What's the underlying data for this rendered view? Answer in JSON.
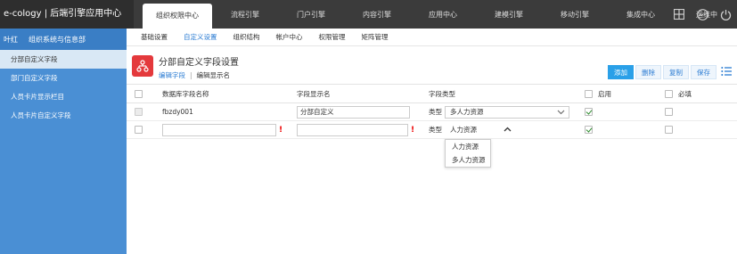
{
  "app": {
    "title": "e-cology | 后端引擎应用中心"
  },
  "topnav": [
    {
      "label": "组织权限中心",
      "active": true
    },
    {
      "label": "流程引擎"
    },
    {
      "label": "门户引擎"
    },
    {
      "label": "内容引擎"
    },
    {
      "label": "应用中心"
    },
    {
      "label": "建模引擎"
    },
    {
      "label": "移动引擎"
    },
    {
      "label": "集成中心"
    },
    {
      "label": "运维中"
    }
  ],
  "top_icons": [
    "grid-icon",
    "more-icon",
    "power-icon"
  ],
  "sidebar": {
    "user": "叶红",
    "dept": "组织系统与信息部",
    "items": [
      {
        "label": "分部自定义字段",
        "active": true
      },
      {
        "label": "部门自定义字段"
      },
      {
        "label": "人员卡片显示栏目"
      },
      {
        "label": "人员卡片自定义字段"
      }
    ]
  },
  "subnav": [
    {
      "label": "基础设置"
    },
    {
      "label": "自定义设置",
      "active": true
    },
    {
      "label": "组织结构"
    },
    {
      "label": "帐户中心"
    },
    {
      "label": "权限管理"
    },
    {
      "label": "矩阵管理"
    }
  ],
  "page": {
    "title": "分部自定义字段设置",
    "link_edit_fields": "编辑字段",
    "link_edit_display": "编辑显示名",
    "icon": "org-chart-icon"
  },
  "actions": {
    "add": "添加",
    "delete": "删除",
    "copy": "复制",
    "save": "保存"
  },
  "table": {
    "columns": {
      "db_name": "数据库字段名称",
      "display_name": "字段显示名",
      "type": "字段类型",
      "enabled": "启用",
      "required": "必填"
    },
    "rows": [
      {
        "db_name": "fbzdy001",
        "display_name": "分部自定义",
        "type_prefix": "类型",
        "type_value": "多人力资源",
        "enabled": true,
        "required": false
      },
      {
        "db_name": "",
        "display_name": "",
        "type_prefix": "类型",
        "type_value": "人力资源",
        "enabled": true,
        "required": false
      }
    ]
  },
  "dropdown": {
    "options": [
      "人力资源",
      "多人力资源"
    ]
  },
  "colors": {
    "topbar": "#3b3b3b",
    "sidebar": "#4a8fd4",
    "accent": "#2b7cd3",
    "primary_button": "#2aa0e8",
    "page_icon": "#e4393c"
  }
}
